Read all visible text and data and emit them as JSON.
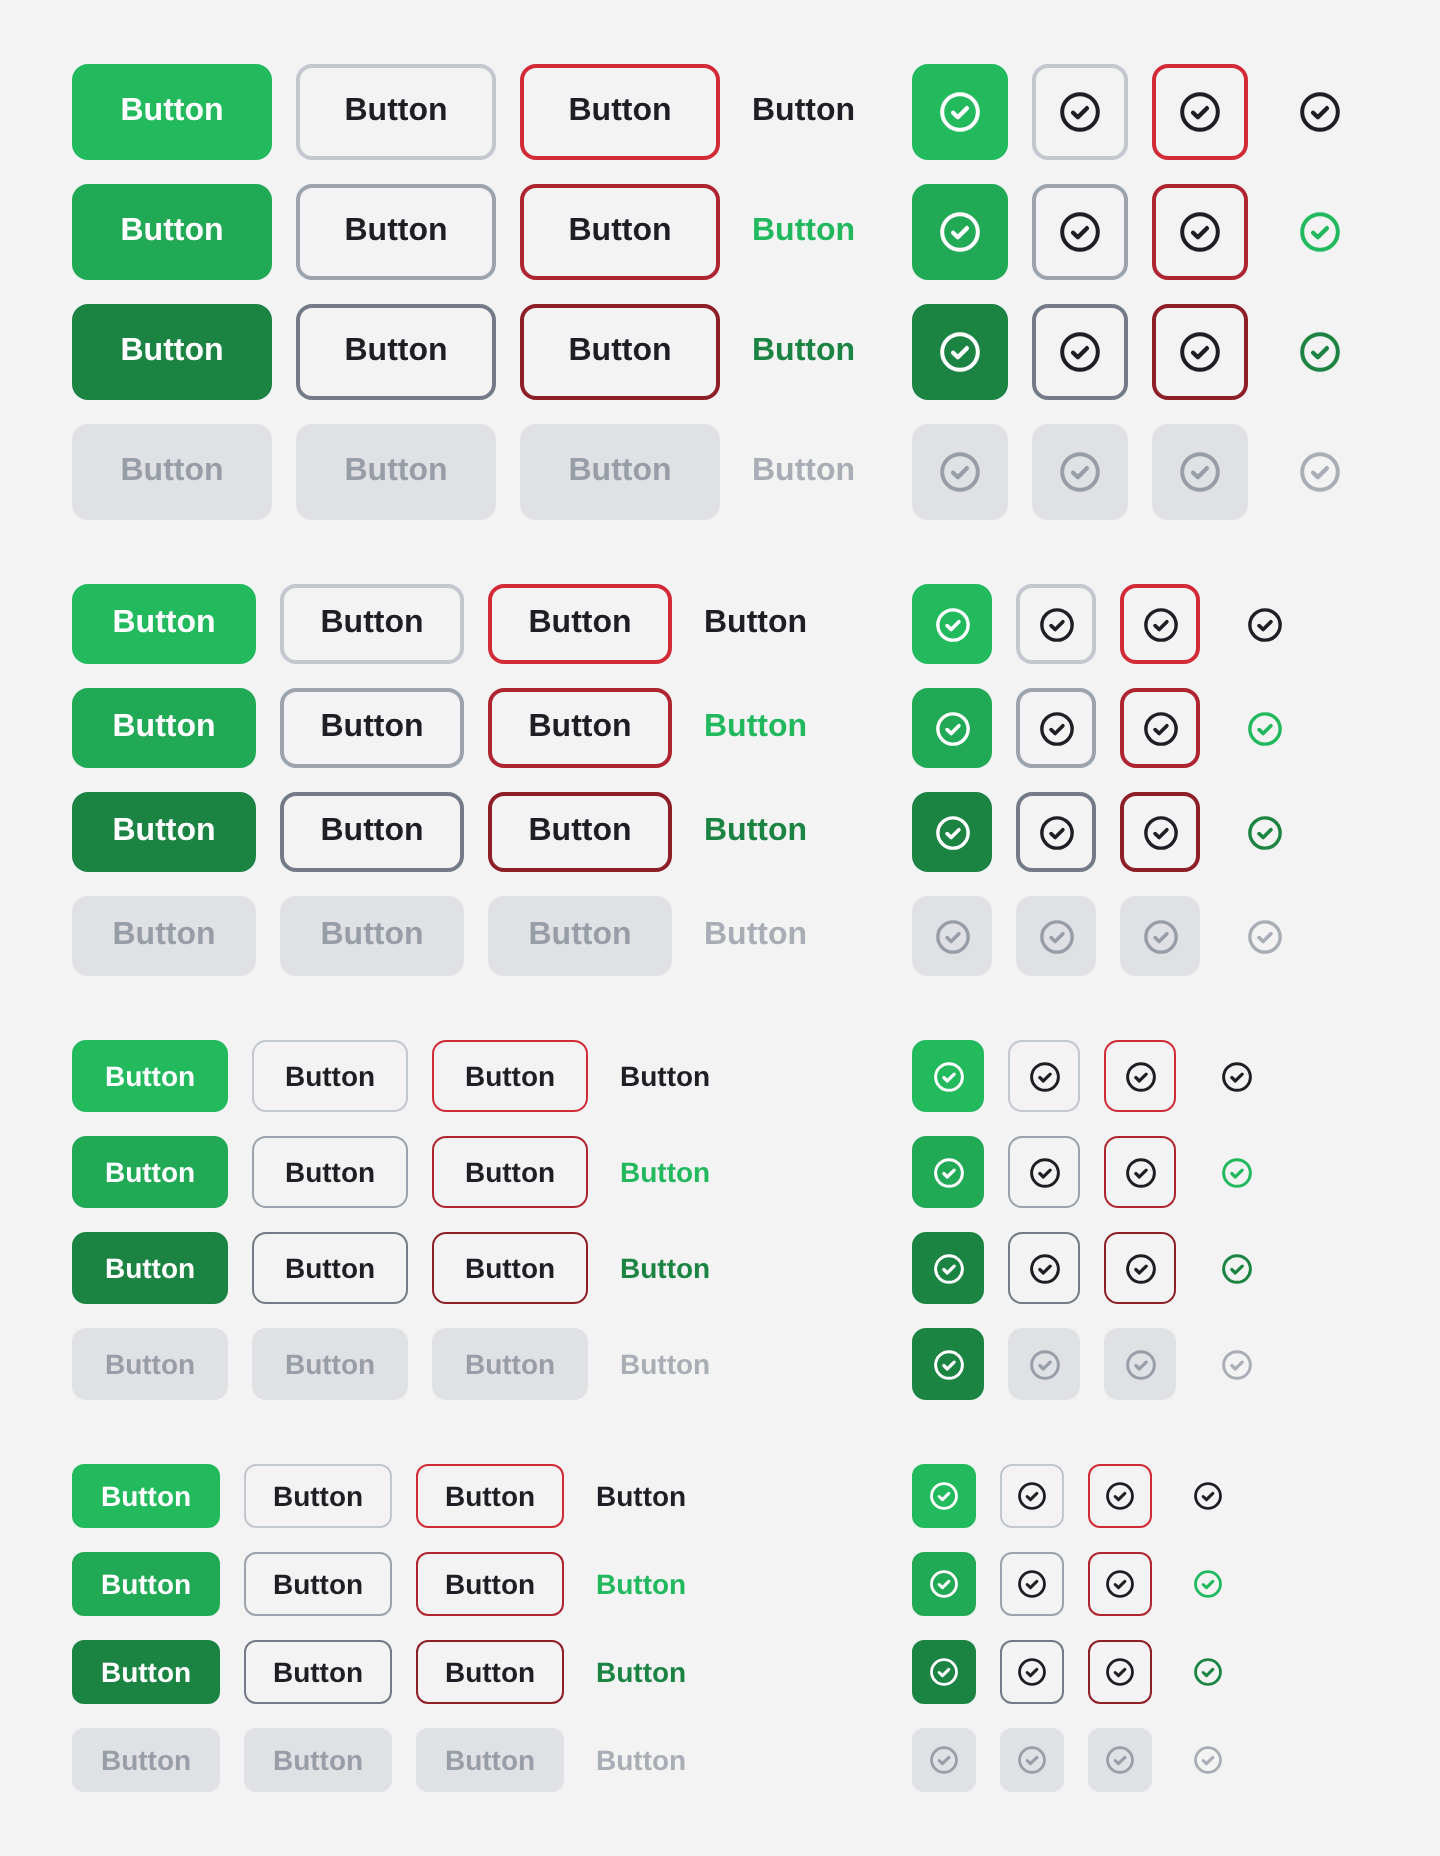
{
  "groups": [
    {
      "kind": "xlarge",
      "rows": [
        {
          "text_buttons": [
            {
              "kind": "primary",
              "hover": false,
              "pressed": false,
              "disabled": false,
              "label": "Button"
            },
            {
              "kind": "secondary",
              "hover": false,
              "pressed": false,
              "disabled": false,
              "label": "Button"
            },
            {
              "kind": "danger",
              "hover": false,
              "pressed": false,
              "disabled": false,
              "label": "Button"
            },
            {
              "kind": "ghost",
              "hover": false,
              "pressed": false,
              "disabled": false,
              "label": "Button"
            }
          ],
          "icon_buttons": [
            {
              "kind": "primary",
              "hover": false,
              "pressed": false,
              "disabled": false
            },
            {
              "kind": "secondary",
              "hover": false,
              "pressed": false,
              "disabled": false
            },
            {
              "kind": "danger",
              "hover": false,
              "pressed": false,
              "disabled": false
            },
            {
              "kind": "ghost",
              "hover": false,
              "pressed": false,
              "disabled": false
            }
          ]
        },
        {
          "text_buttons": [
            {
              "kind": "primary",
              "hover": true,
              "pressed": false,
              "disabled": false,
              "label": "Button"
            },
            {
              "kind": "secondary",
              "hover": true,
              "pressed": false,
              "disabled": false,
              "label": "Button"
            },
            {
              "kind": "danger",
              "hover": true,
              "pressed": false,
              "disabled": false,
              "label": "Button"
            },
            {
              "kind": "ghost",
              "hover": true,
              "pressed": false,
              "disabled": false,
              "label": "Button"
            }
          ],
          "icon_buttons": [
            {
              "kind": "primary",
              "hover": true,
              "pressed": false,
              "disabled": false
            },
            {
              "kind": "secondary",
              "hover": true,
              "pressed": false,
              "disabled": false
            },
            {
              "kind": "danger",
              "hover": true,
              "pressed": false,
              "disabled": false
            },
            {
              "kind": "ghost",
              "hover": true,
              "pressed": false,
              "disabled": false
            }
          ]
        },
        {
          "text_buttons": [
            {
              "kind": "primary",
              "hover": false,
              "pressed": true,
              "disabled": false,
              "label": "Button"
            },
            {
              "kind": "secondary",
              "hover": false,
              "pressed": true,
              "disabled": false,
              "label": "Button"
            },
            {
              "kind": "danger",
              "hover": false,
              "pressed": true,
              "disabled": false,
              "label": "Button"
            },
            {
              "kind": "ghost",
              "hover": false,
              "pressed": true,
              "disabled": false,
              "label": "Button"
            }
          ],
          "icon_buttons": [
            {
              "kind": "primary",
              "hover": false,
              "pressed": true,
              "disabled": false
            },
            {
              "kind": "secondary",
              "hover": false,
              "pressed": true,
              "disabled": false
            },
            {
              "kind": "danger",
              "hover": false,
              "pressed": true,
              "disabled": false
            },
            {
              "kind": "ghost",
              "hover": false,
              "pressed": true,
              "disabled": false
            }
          ]
        },
        {
          "text_buttons": [
            {
              "kind": "primary",
              "hover": false,
              "pressed": false,
              "disabled": true,
              "label": "Button"
            },
            {
              "kind": "secondary",
              "hover": false,
              "pressed": false,
              "disabled": true,
              "label": "Button"
            },
            {
              "kind": "danger",
              "hover": false,
              "pressed": false,
              "disabled": true,
              "label": "Button"
            },
            {
              "kind": "ghost",
              "hover": false,
              "pressed": false,
              "disabled": true,
              "label": "Button"
            }
          ],
          "icon_buttons": [
            {
              "kind": "primary",
              "hover": false,
              "pressed": false,
              "disabled": true
            },
            {
              "kind": "secondary",
              "hover": false,
              "pressed": false,
              "disabled": true
            },
            {
              "kind": "danger",
              "hover": false,
              "pressed": false,
              "disabled": true
            },
            {
              "kind": "ghost",
              "hover": false,
              "pressed": false,
              "disabled": true
            }
          ]
        }
      ]
    },
    {
      "kind": "large",
      "rows": [
        {
          "text_buttons": [
            {
              "kind": "primary",
              "hover": false,
              "pressed": false,
              "disabled": false,
              "label": "Button"
            },
            {
              "kind": "secondary",
              "hover": false,
              "pressed": false,
              "disabled": false,
              "label": "Button"
            },
            {
              "kind": "danger",
              "hover": false,
              "pressed": false,
              "disabled": false,
              "label": "Button"
            },
            {
              "kind": "ghost",
              "hover": false,
              "pressed": false,
              "disabled": false,
              "label": "Button"
            }
          ],
          "icon_buttons": [
            {
              "kind": "primary",
              "hover": false,
              "pressed": false,
              "disabled": false
            },
            {
              "kind": "secondary",
              "hover": false,
              "pressed": false,
              "disabled": false
            },
            {
              "kind": "danger",
              "hover": false,
              "pressed": false,
              "disabled": false
            },
            {
              "kind": "ghost",
              "hover": false,
              "pressed": false,
              "disabled": false
            }
          ]
        },
        {
          "text_buttons": [
            {
              "kind": "primary",
              "hover": true,
              "pressed": false,
              "disabled": false,
              "label": "Button"
            },
            {
              "kind": "secondary",
              "hover": true,
              "pressed": false,
              "disabled": false,
              "label": "Button"
            },
            {
              "kind": "danger",
              "hover": true,
              "pressed": false,
              "disabled": false,
              "label": "Button"
            },
            {
              "kind": "ghost",
              "hover": true,
              "pressed": false,
              "disabled": false,
              "label": "Button"
            }
          ],
          "icon_buttons": [
            {
              "kind": "primary",
              "hover": true,
              "pressed": false,
              "disabled": false
            },
            {
              "kind": "secondary",
              "hover": true,
              "pressed": false,
              "disabled": false
            },
            {
              "kind": "danger",
              "hover": true,
              "pressed": false,
              "disabled": false
            },
            {
              "kind": "ghost",
              "hover": true,
              "pressed": false,
              "disabled": false
            }
          ]
        },
        {
          "text_buttons": [
            {
              "kind": "primary",
              "hover": false,
              "pressed": true,
              "disabled": false,
              "label": "Button"
            },
            {
              "kind": "secondary",
              "hover": false,
              "pressed": true,
              "disabled": false,
              "label": "Button"
            },
            {
              "kind": "danger",
              "hover": false,
              "pressed": true,
              "disabled": false,
              "label": "Button"
            },
            {
              "kind": "ghost",
              "hover": false,
              "pressed": true,
              "disabled": false,
              "label": "Button"
            }
          ],
          "icon_buttons": [
            {
              "kind": "primary",
              "hover": false,
              "pressed": true,
              "disabled": false
            },
            {
              "kind": "secondary",
              "hover": false,
              "pressed": true,
              "disabled": false
            },
            {
              "kind": "danger",
              "hover": false,
              "pressed": true,
              "disabled": false
            },
            {
              "kind": "ghost",
              "hover": false,
              "pressed": true,
              "disabled": false
            }
          ]
        },
        {
          "text_buttons": [
            {
              "kind": "primary",
              "hover": false,
              "pressed": false,
              "disabled": true,
              "label": "Button"
            },
            {
              "kind": "secondary",
              "hover": false,
              "pressed": false,
              "disabled": true,
              "label": "Button"
            },
            {
              "kind": "danger",
              "hover": false,
              "pressed": false,
              "disabled": true,
              "label": "Button"
            },
            {
              "kind": "ghost",
              "hover": false,
              "pressed": false,
              "disabled": true,
              "label": "Button"
            }
          ],
          "icon_buttons": [
            {
              "kind": "primary",
              "hover": false,
              "pressed": false,
              "disabled": true
            },
            {
              "kind": "secondary",
              "hover": false,
              "pressed": false,
              "disabled": true
            },
            {
              "kind": "danger",
              "hover": false,
              "pressed": false,
              "disabled": true
            },
            {
              "kind": "ghost",
              "hover": false,
              "pressed": false,
              "disabled": true
            }
          ]
        }
      ]
    },
    {
      "kind": "medium",
      "rows": [
        {
          "text_buttons": [
            {
              "kind": "primary",
              "hover": false,
              "pressed": false,
              "disabled": false,
              "label": "Button"
            },
            {
              "kind": "secondary",
              "hover": false,
              "pressed": false,
              "disabled": false,
              "label": "Button"
            },
            {
              "kind": "danger",
              "hover": false,
              "pressed": false,
              "disabled": false,
              "label": "Button"
            },
            {
              "kind": "ghost",
              "hover": false,
              "pressed": false,
              "disabled": false,
              "label": "Button"
            }
          ],
          "icon_buttons": [
            {
              "kind": "primary",
              "hover": false,
              "pressed": false,
              "disabled": false
            },
            {
              "kind": "secondary",
              "hover": false,
              "pressed": false,
              "disabled": false
            },
            {
              "kind": "danger",
              "hover": false,
              "pressed": false,
              "disabled": false
            },
            {
              "kind": "ghost",
              "hover": false,
              "pressed": false,
              "disabled": false
            }
          ]
        },
        {
          "text_buttons": [
            {
              "kind": "primary",
              "hover": true,
              "pressed": false,
              "disabled": false,
              "label": "Button"
            },
            {
              "kind": "secondary",
              "hover": true,
              "pressed": false,
              "disabled": false,
              "label": "Button"
            },
            {
              "kind": "danger",
              "hover": true,
              "pressed": false,
              "disabled": false,
              "label": "Button"
            },
            {
              "kind": "ghost",
              "hover": true,
              "pressed": false,
              "disabled": false,
              "label": "Button"
            }
          ],
          "icon_buttons": [
            {
              "kind": "primary",
              "hover": true,
              "pressed": false,
              "disabled": false
            },
            {
              "kind": "secondary",
              "hover": true,
              "pressed": false,
              "disabled": false
            },
            {
              "kind": "danger",
              "hover": true,
              "pressed": false,
              "disabled": false
            },
            {
              "kind": "ghost",
              "hover": true,
              "pressed": false,
              "disabled": false
            }
          ]
        },
        {
          "text_buttons": [
            {
              "kind": "primary",
              "hover": false,
              "pressed": true,
              "disabled": false,
              "label": "Button"
            },
            {
              "kind": "secondary",
              "hover": false,
              "pressed": true,
              "disabled": false,
              "label": "Button"
            },
            {
              "kind": "danger",
              "hover": false,
              "pressed": true,
              "disabled": false,
              "label": "Button"
            },
            {
              "kind": "ghost",
              "hover": false,
              "pressed": true,
              "disabled": false,
              "label": "Button"
            }
          ],
          "icon_buttons": [
            {
              "kind": "primary",
              "hover": false,
              "pressed": true,
              "disabled": false
            },
            {
              "kind": "secondary",
              "hover": false,
              "pressed": true,
              "disabled": false
            },
            {
              "kind": "danger",
              "hover": false,
              "pressed": true,
              "disabled": false
            },
            {
              "kind": "ghost",
              "hover": false,
              "pressed": true,
              "disabled": false
            }
          ]
        },
        {
          "text_buttons": [
            {
              "kind": "primary",
              "hover": false,
              "pressed": false,
              "disabled": true,
              "label": "Button"
            },
            {
              "kind": "secondary",
              "hover": false,
              "pressed": false,
              "disabled": true,
              "label": "Button"
            },
            {
              "kind": "danger",
              "hover": false,
              "pressed": false,
              "disabled": true,
              "label": "Button"
            },
            {
              "kind": "ghost",
              "hover": false,
              "pressed": false,
              "disabled": true,
              "label": "Button"
            }
          ],
          "icon_buttons": [
            {
              "kind": "primary",
              "hover": false,
              "pressed": true,
              "disabled": false
            },
            {
              "kind": "secondary",
              "hover": false,
              "pressed": false,
              "disabled": true
            },
            {
              "kind": "danger",
              "hover": false,
              "pressed": false,
              "disabled": true
            },
            {
              "kind": "ghost",
              "hover": false,
              "pressed": false,
              "disabled": true
            }
          ]
        }
      ]
    },
    {
      "kind": "small",
      "rows": [
        {
          "text_buttons": [
            {
              "kind": "primary",
              "hover": false,
              "pressed": false,
              "disabled": false,
              "label": "Button"
            },
            {
              "kind": "secondary",
              "hover": false,
              "pressed": false,
              "disabled": false,
              "label": "Button"
            },
            {
              "kind": "danger",
              "hover": false,
              "pressed": false,
              "disabled": false,
              "label": "Button"
            },
            {
              "kind": "ghost",
              "hover": false,
              "pressed": false,
              "disabled": false,
              "label": "Button"
            }
          ],
          "icon_buttons": [
            {
              "kind": "primary",
              "hover": false,
              "pressed": false,
              "disabled": false
            },
            {
              "kind": "secondary",
              "hover": false,
              "pressed": false,
              "disabled": false
            },
            {
              "kind": "danger",
              "hover": false,
              "pressed": false,
              "disabled": false
            },
            {
              "kind": "ghost",
              "hover": false,
              "pressed": false,
              "disabled": false
            }
          ]
        },
        {
          "text_buttons": [
            {
              "kind": "primary",
              "hover": true,
              "pressed": false,
              "disabled": false,
              "label": "Button"
            },
            {
              "kind": "secondary",
              "hover": true,
              "pressed": false,
              "disabled": false,
              "label": "Button"
            },
            {
              "kind": "danger",
              "hover": true,
              "pressed": false,
              "disabled": false,
              "label": "Button"
            },
            {
              "kind": "ghost",
              "hover": true,
              "pressed": false,
              "disabled": false,
              "label": "Button"
            }
          ],
          "icon_buttons": [
            {
              "kind": "primary",
              "hover": true,
              "pressed": false,
              "disabled": false
            },
            {
              "kind": "secondary",
              "hover": true,
              "pressed": false,
              "disabled": false
            },
            {
              "kind": "danger",
              "hover": true,
              "pressed": false,
              "disabled": false
            },
            {
              "kind": "ghost",
              "hover": true,
              "pressed": false,
              "disabled": false
            }
          ]
        },
        {
          "text_buttons": [
            {
              "kind": "primary",
              "hover": false,
              "pressed": true,
              "disabled": false,
              "label": "Button"
            },
            {
              "kind": "secondary",
              "hover": false,
              "pressed": true,
              "disabled": false,
              "label": "Button"
            },
            {
              "kind": "danger",
              "hover": false,
              "pressed": true,
              "disabled": false,
              "label": "Button"
            },
            {
              "kind": "ghost",
              "hover": false,
              "pressed": true,
              "disabled": false,
              "label": "Button"
            }
          ],
          "icon_buttons": [
            {
              "kind": "primary",
              "hover": false,
              "pressed": true,
              "disabled": false
            },
            {
              "kind": "secondary",
              "hover": false,
              "pressed": true,
              "disabled": false
            },
            {
              "kind": "danger",
              "hover": false,
              "pressed": true,
              "disabled": false
            },
            {
              "kind": "ghost",
              "hover": false,
              "pressed": true,
              "disabled": false
            }
          ]
        },
        {
          "text_buttons": [
            {
              "kind": "primary",
              "hover": false,
              "pressed": false,
              "disabled": true,
              "label": "Button"
            },
            {
              "kind": "secondary",
              "hover": false,
              "pressed": false,
              "disabled": true,
              "label": "Button"
            },
            {
              "kind": "danger",
              "hover": false,
              "pressed": false,
              "disabled": true,
              "label": "Button"
            },
            {
              "kind": "ghost",
              "hover": false,
              "pressed": false,
              "disabled": true,
              "label": "Button"
            }
          ],
          "icon_buttons": [
            {
              "kind": "primary",
              "hover": false,
              "pressed": false,
              "disabled": true
            },
            {
              "kind": "secondary",
              "hover": false,
              "pressed": false,
              "disabled": true
            },
            {
              "kind": "danger",
              "hover": false,
              "pressed": false,
              "disabled": true
            },
            {
              "kind": "ghost",
              "hover": false,
              "pressed": false,
              "disabled": true
            }
          ]
        }
      ]
    }
  ]
}
